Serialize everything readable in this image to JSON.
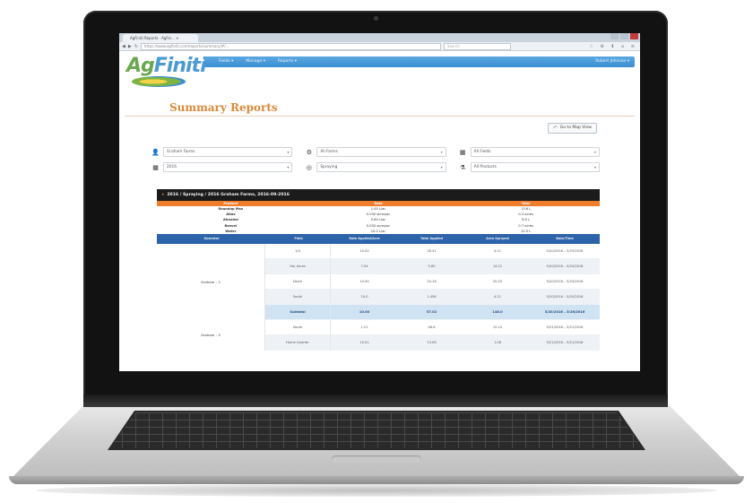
{
  "browser": {
    "tab_title": "AgFiniti Reports · AgFin... ×",
    "url": "https://www.agfiniti.com/reports/summary/#/...",
    "search_placeholder": "Search",
    "tool_icons": "☆ ⊕ ⬇ ⌂ ≡"
  },
  "brand": {
    "logo_ag": "Ag",
    "logo_rest": "Finiti",
    "registered": "®"
  },
  "nav": {
    "items": [
      "Fields ▾",
      "Manage ▾",
      "Reports ▾"
    ],
    "user": "Robert Johnson ▾"
  },
  "page": {
    "title": "Summary Reports",
    "back_button": "Go to Map View"
  },
  "filters": {
    "row1": [
      {
        "icon": "user-icon",
        "glyph": "👤",
        "value": "Graham Farms"
      },
      {
        "icon": "tractor-icon",
        "glyph": "⚙",
        "value": "All Farms"
      },
      {
        "icon": "field-icon",
        "glyph": "▦",
        "value": "All Fields"
      }
    ],
    "row2": [
      {
        "icon": "calendar-icon",
        "glyph": "▦",
        "value": "2016"
      },
      {
        "icon": "target-icon",
        "glyph": "◎",
        "value": "Spraying"
      },
      {
        "icon": "product-icon",
        "glyph": "⚗",
        "value": "All Products"
      }
    ]
  },
  "report": {
    "header": "2016 / Spraying / 2016 Graham Farms, 2016-09-2016",
    "summary_headers": [
      "Product",
      "Rate",
      "Total"
    ],
    "summary_rows": [
      [
        "Roundup Max",
        "1.00 L/ac",
        "13.6 L"
      ],
      [
        "Atlas",
        "0.030 acres/ac",
        "0.3 acres"
      ],
      [
        "Atrazine",
        "0.60 L/ac",
        "8.0 L"
      ],
      [
        "Banvel",
        "0.030 acres/ac",
        "0.7 acres"
      ],
      [
        "Water",
        "10.0 L/ac",
        "12.5 L"
      ]
    ],
    "table_headers": [
      "Operator",
      "Field",
      "Rate Applied/Acre",
      "Total Applied",
      "Area Sprayed",
      "Date/Time"
    ],
    "regions": [
      {
        "name": "Graham – 1",
        "rows": [
          [
            "1/4",
            "10.00",
            "28.51",
            "4.21",
            "5/20/2016 – 5/25/2016"
          ],
          [
            "Hw. Acres",
            "7.04",
            "5.80",
            "14.21",
            "5/20/2016 – 5/20/2016"
          ],
          [
            "North",
            "10.00",
            "20.16",
            "20.05",
            "5/20/2016 – 5/20/2016"
          ],
          [
            "South",
            "10.0",
            "1.456",
            "4.21",
            "5/20/2016 – 5/20/2016"
          ],
          [
            "Subtotal",
            "10.00",
            "57.02",
            "148.0",
            "5/20/2016 – 5/26/2016"
          ]
        ],
        "subtotal_index": 4
      },
      {
        "name": "Graham – 2",
        "rows": [
          [
            "South",
            "1.21",
            "48.6",
            "12.10",
            "5/21/2016 – 5/21/2016"
          ],
          [
            "Home Quarter",
            "10.01",
            "13.06",
            "1.08",
            "5/21/2016 – 5/21/2016"
          ]
        ],
        "subtotal_index": -1
      }
    ]
  },
  "colors": {
    "nav_blue": "#3b8ed2",
    "title_orange": "#d98a3a",
    "report_black": "#1b1b1b",
    "summary_orange": "#ee7d2c",
    "table_blue": "#2d63a8",
    "subtotal_blue": "#cfe3f3"
  }
}
